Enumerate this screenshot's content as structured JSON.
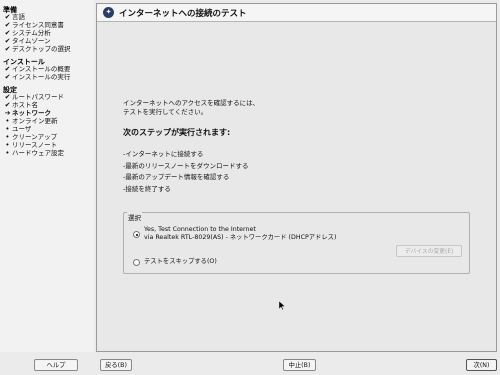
{
  "sidebar": {
    "sections": [
      {
        "title": "準備",
        "items": [
          {
            "label": "言語",
            "mark": "✔"
          },
          {
            "label": "ライセンス同意書",
            "mark": "✔"
          },
          {
            "label": "システム分析",
            "mark": "✔"
          },
          {
            "label": "タイムゾーン",
            "mark": "✔"
          },
          {
            "label": "デスクトップの選択",
            "mark": "✔"
          }
        ]
      },
      {
        "title": "インストール",
        "items": [
          {
            "label": "インストールの概要",
            "mark": "✔"
          },
          {
            "label": "インストールの実行",
            "mark": "✔"
          }
        ]
      },
      {
        "title": "設定",
        "items": [
          {
            "label": "ルートパスワード",
            "mark": "✔"
          },
          {
            "label": "ホスト名",
            "mark": "✔"
          },
          {
            "label": "ネットワーク",
            "mark": "➔"
          },
          {
            "label": "オンライン更新",
            "mark": "•"
          },
          {
            "label": "ユーザ",
            "mark": "•"
          },
          {
            "label": "クリーンアップ",
            "mark": "•"
          },
          {
            "label": "リリースノート",
            "mark": "•"
          },
          {
            "label": "ハードウェア設定",
            "mark": "•"
          }
        ]
      }
    ]
  },
  "panel": {
    "title": "インターネットへの接続のテスト",
    "intro_line1": "インターネットへのアクセスを確認するには、",
    "intro_line2": "テストを実行してください。",
    "next_heading": "次のステップが実行されます:",
    "steps": [
      "-インターネットに接続する",
      "-最新のリリースノートをダウンロードする",
      "-最新のアップデート情報を確認する",
      "-接続を終了する"
    ],
    "group_label": "選択",
    "option_yes_line1": "Yes, Test Connection to the Internet",
    "option_yes_line2": "via Realtek RTL-8029(AS) - ネットワークカード (DHCPアドレス)",
    "option_skip": "テストをスキップする(O)",
    "device_change_button": "デバイスの変更(E)"
  },
  "footer": {
    "help": "ヘルプ",
    "back": "戻る(B)",
    "abort": "中止(B)",
    "next": "次(N)"
  },
  "colors": {
    "title_icon": "#2d3e66",
    "background": "#ebebeb"
  }
}
